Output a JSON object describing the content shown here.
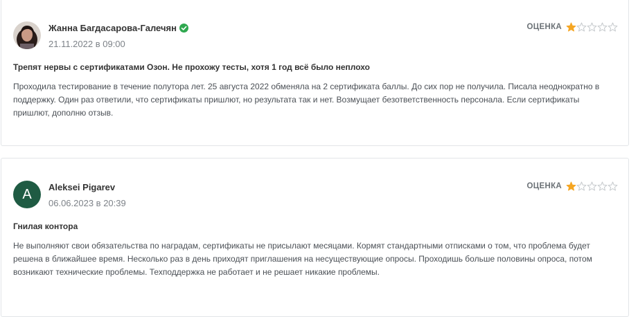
{
  "reviews": [
    {
      "author": "Жанна Багдасарова-Галечян",
      "verified": true,
      "date": "21.11.2022 в 09:00",
      "rating_label": "ОЦЕНКА",
      "rating": 1,
      "max_rating": 5,
      "title": "Трепят нервы с сертификатами Озон. Не прохожу тесты, хотя 1 год всё было неплохо",
      "text": "Проходила тестирование в течение полутора лет. 25 августа 2022 обменяла на 2 сертификата баллы. До сих пор не получила. Писала неоднократно в поддержку. Один раз ответили, что сертификаты пришлют, но результата так и нет. Возмущает безответственность персонала. Если сертификаты пришлют, дополню отзыв."
    },
    {
      "author": "Aleksei Pigarev",
      "avatar_letter": "A",
      "date": "06.06.2023 в 20:39",
      "rating_label": "ОЦЕНКА",
      "rating": 1,
      "max_rating": 5,
      "title": "Гнилая контора",
      "text": "Не выполняют свои обязательства по наградам, сертификаты не присылают месяцами. Кормят стандартными отписками о том, что проблема будет решена в ближайшее время. Несколько раз в день приходят приглашения на несуществующие опросы. Проходишь больше половины опроса, потом возникают технические проблемы. Техподдержка не работает и не решает никакие проблемы."
    }
  ],
  "colors": {
    "star_filled": "#f5a623",
    "star_empty": "#c5c9cc",
    "verified": "#2fa84f",
    "avatar_bg": "#1f5b43"
  }
}
